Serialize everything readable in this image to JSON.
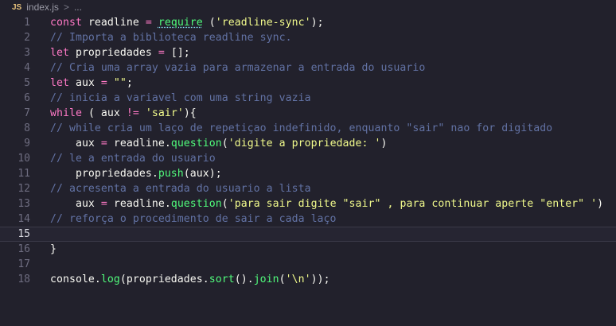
{
  "breadcrumb": {
    "badge": "JS",
    "filename": "index.js",
    "separator": ">",
    "more": "..."
  },
  "colors": {
    "background": "#22212c",
    "keyword": "#ff79c6",
    "string": "#f1fa8c",
    "function": "#50fa7b",
    "comment": "#6272a4"
  },
  "current_line": 15,
  "lines": [
    {
      "num": "1",
      "tokens": [
        [
          "kw",
          "const"
        ],
        [
          "var",
          " readline "
        ],
        [
          "op",
          "="
        ],
        [
          "pn",
          " "
        ],
        [
          "fn",
          "require"
        ],
        [
          "pn",
          " ("
        ],
        [
          "str",
          "'readline-sync'"
        ],
        [
          "pn",
          ");"
        ]
      ]
    },
    {
      "num": "2",
      "tokens": [
        [
          "cm",
          "// Importa a biblioteca readline sync."
        ]
      ]
    },
    {
      "num": "3",
      "tokens": [
        [
          "kw",
          "let"
        ],
        [
          "var",
          " propriedades "
        ],
        [
          "op",
          "="
        ],
        [
          "pn",
          " [];"
        ]
      ]
    },
    {
      "num": "4",
      "tokens": [
        [
          "cm",
          "// Cria uma array vazia para armazenar a entrada do usuario"
        ]
      ]
    },
    {
      "num": "5",
      "tokens": [
        [
          "kw",
          "let"
        ],
        [
          "var",
          " aux "
        ],
        [
          "op",
          "="
        ],
        [
          "pn",
          " "
        ],
        [
          "str",
          "\"\""
        ],
        [
          "pn",
          ";"
        ]
      ]
    },
    {
      "num": "6",
      "tokens": [
        [
          "cm",
          "// inicia a variavel com uma string vazia"
        ]
      ]
    },
    {
      "num": "7",
      "tokens": [
        [
          "kw",
          "while"
        ],
        [
          "pn",
          " ( aux "
        ],
        [
          "op",
          "!="
        ],
        [
          "pn",
          " "
        ],
        [
          "str",
          "'sair'"
        ],
        [
          "pn",
          "){"
        ]
      ]
    },
    {
      "num": "8",
      "tokens": [
        [
          "cm",
          "// while cria um laço de repetiçao indefinido, enquanto \"sair\" nao for digitado"
        ]
      ]
    },
    {
      "num": "9",
      "tokens": [
        [
          "pn",
          "    aux "
        ],
        [
          "op",
          "="
        ],
        [
          "pn",
          " readline."
        ],
        [
          "fn",
          "question"
        ],
        [
          "pn",
          "("
        ],
        [
          "str",
          "'digite a propriedade: '"
        ],
        [
          "pn",
          ")"
        ]
      ]
    },
    {
      "num": "10",
      "tokens": [
        [
          "cm",
          "// le a entrada do usuario"
        ]
      ]
    },
    {
      "num": "11",
      "tokens": [
        [
          "pn",
          "    propriedades."
        ],
        [
          "fn",
          "push"
        ],
        [
          "pn",
          "(aux);"
        ]
      ]
    },
    {
      "num": "12",
      "tokens": [
        [
          "cm",
          "// acresenta a entrada do usuario a lista"
        ]
      ]
    },
    {
      "num": "13",
      "tokens": [
        [
          "pn",
          "    aux "
        ],
        [
          "op",
          "="
        ],
        [
          "pn",
          " readline."
        ],
        [
          "fn",
          "question"
        ],
        [
          "pn",
          "("
        ],
        [
          "str",
          "'para sair digite \"sair\" , para continuar aperte \"enter\" '"
        ],
        [
          "pn",
          ")"
        ]
      ]
    },
    {
      "num": "14",
      "tokens": [
        [
          "cm",
          "// reforça o procedimento de sair a cada laço"
        ]
      ]
    },
    {
      "num": "15",
      "tokens": []
    },
    {
      "num": "16",
      "tokens": [
        [
          "pn",
          "}"
        ]
      ]
    },
    {
      "num": "17",
      "tokens": []
    },
    {
      "num": "18",
      "tokens": [
        [
          "pn",
          "console."
        ],
        [
          "fn",
          "log"
        ],
        [
          "pn",
          "(propriedades."
        ],
        [
          "fn",
          "sort"
        ],
        [
          "pn",
          "()."
        ],
        [
          "fn",
          "join"
        ],
        [
          "pn",
          "("
        ],
        [
          "str",
          "'\\n'"
        ],
        [
          "pn",
          "));"
        ]
      ]
    }
  ]
}
